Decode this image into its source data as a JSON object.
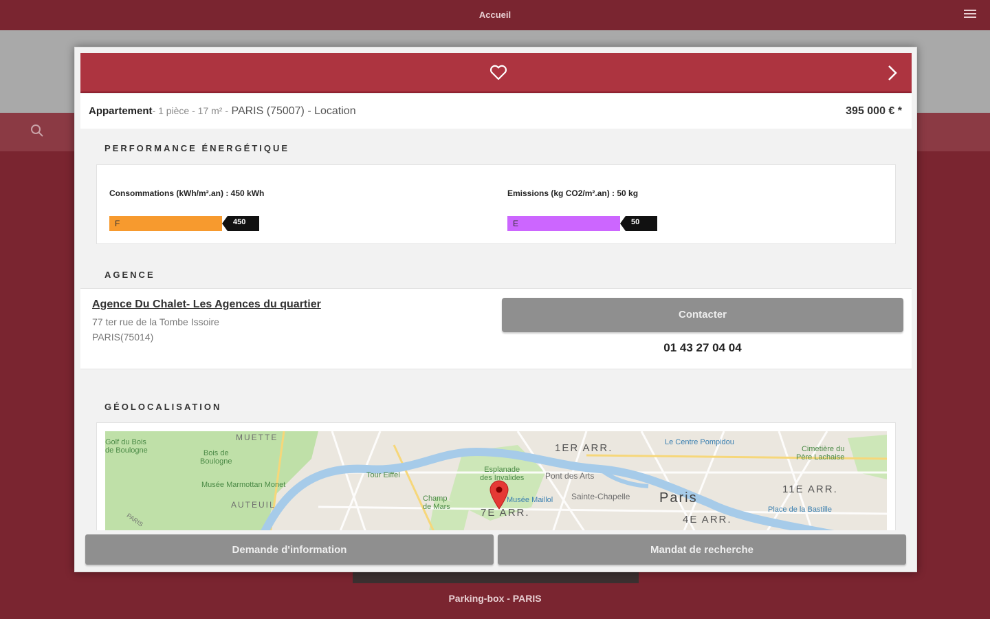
{
  "header": {
    "title": "Accueil",
    "menu_icon": "hamburger-menu-icon"
  },
  "search": {
    "icon": "search-icon"
  },
  "background_listing": {
    "caption": "Parking-box - PARIS"
  },
  "modal": {
    "favorite_icon": "heart-icon",
    "next_icon": "chevron-right-icon",
    "accent_color": "#ad3440",
    "summary": {
      "type": "Appartement",
      "details": "- 1 pièce - 17 m² -",
      "location": "PARIS (75007) - Location",
      "price": "395 000 € *"
    },
    "energy": {
      "title": "PERFORMANCE ÉNERGÉTIQUE",
      "consumption": {
        "label": "Consommations (kWh/m².an) : 450 kWh",
        "class": "F",
        "value": "450",
        "color": "#f79a2e"
      },
      "emissions": {
        "label": "Emissions (kg CO2/m².an) : 50 kg",
        "class": "E",
        "value": "50",
        "color": "#cc66ff"
      }
    },
    "agency": {
      "title": "AGENCE",
      "name": "Agence Du Chalet- Les Agences du quartier",
      "address_line1": "77 ter rue de la Tombe Issoire",
      "address_line2": "PARIS(75014)",
      "contact_label": "Contacter",
      "phone": "01 43 27 04 04"
    },
    "geo": {
      "title": "GÉOLOCALISATION",
      "labels": {
        "golf": "Golf du Bois\nde Boulogne",
        "bois": "Bois de\nBoulogne",
        "muette": "MUETTE",
        "marmottan": "Musée Marmottan Monet",
        "auteuil": "AUTEUIL",
        "tour": "Tour Eiffel",
        "champ": "Champ\nde Mars",
        "esplanade": "Esplanade\ndes Invalides",
        "arr7": "7E ARR.",
        "musee": "Musée Maillol",
        "pont": "Pont des Arts",
        "arr1": "1ER ARR.",
        "chapelle": "Sainte-Chapelle",
        "paris": "Paris",
        "pompidou": "Le Centre Pompidou",
        "arr4": "4E ARR.",
        "arr11": "11E ARR.",
        "bastille": "Place de la Bastille",
        "lachaise": "Cimetière du\nPère Lachaise",
        "paris_road": "PARIS"
      },
      "pin_icon": "map-pin-icon"
    },
    "footer": {
      "info_button": "Demande d'information",
      "mandate_button": "Mandat de recherche"
    }
  }
}
